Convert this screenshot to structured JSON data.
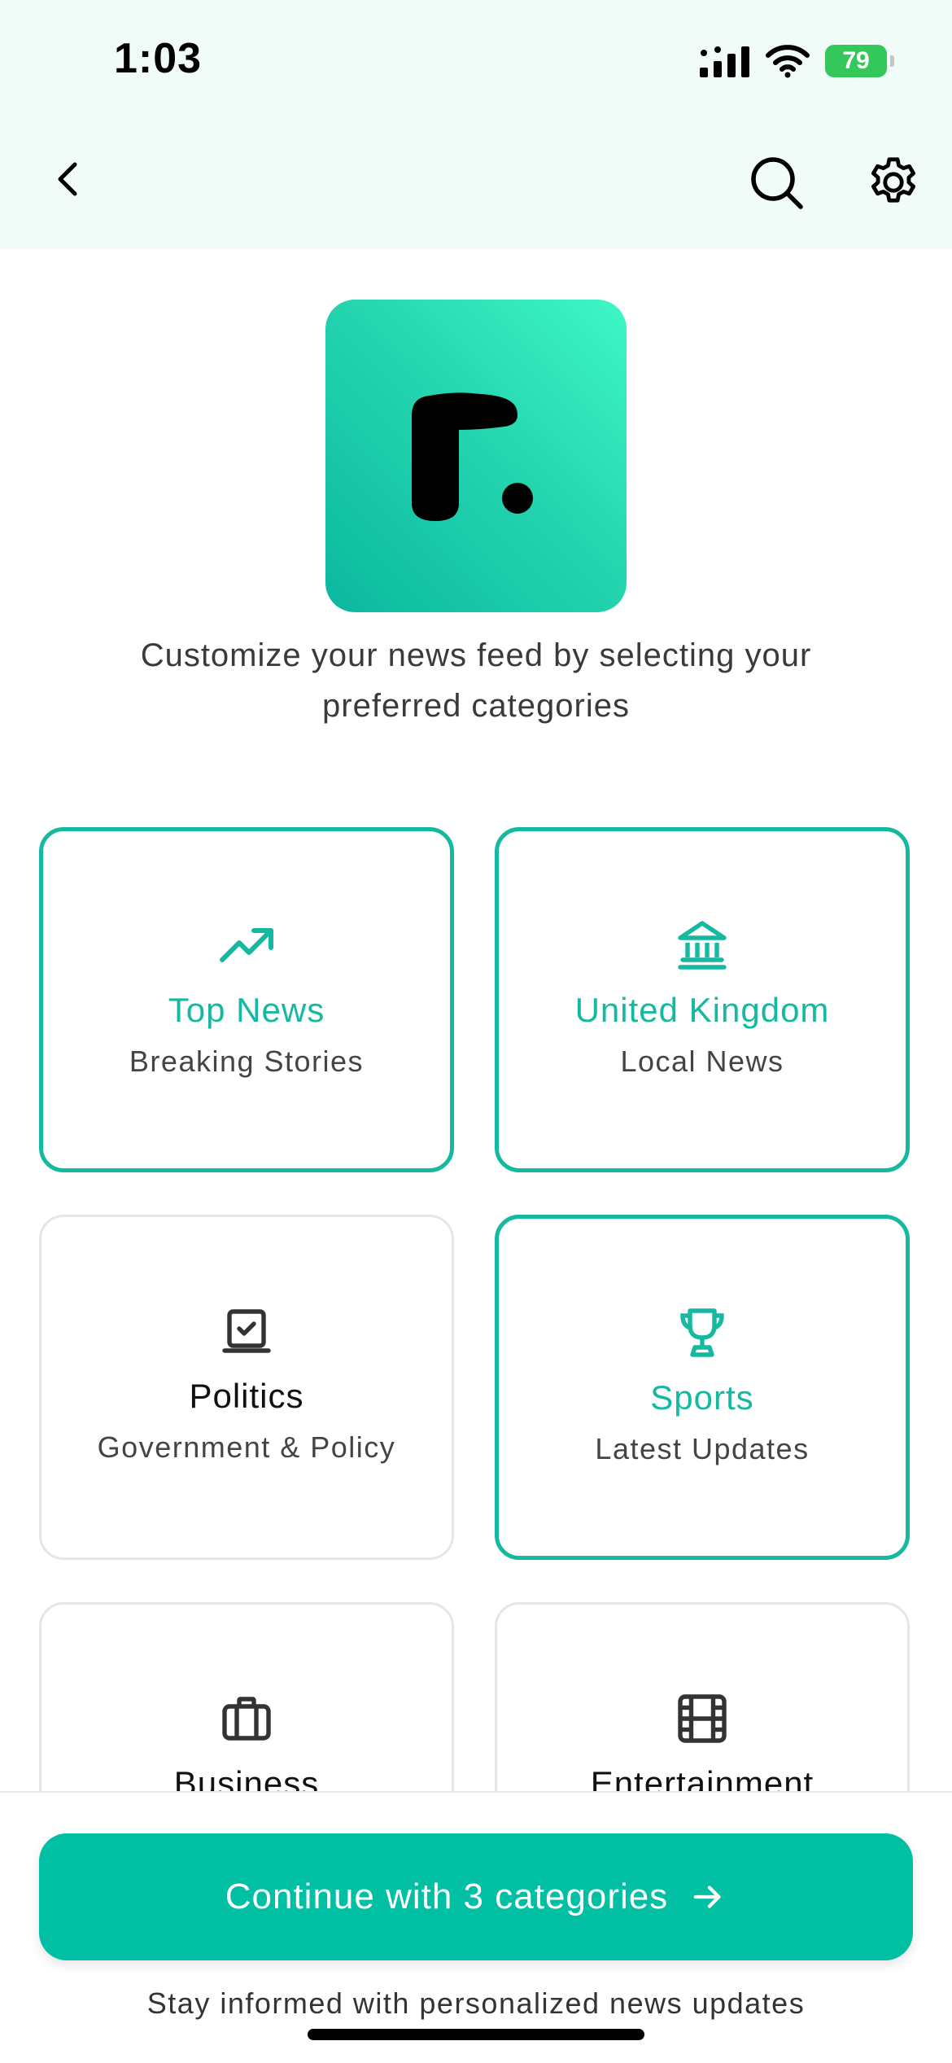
{
  "status_bar": {
    "time": "1:03",
    "battery": "79"
  },
  "intro_text": "Customize your news feed by selecting your preferred categories",
  "categories": [
    {
      "title": "Top News",
      "subtitle": "Breaking Stories",
      "icon": "trending-up-icon",
      "selected": true
    },
    {
      "title": "United Kingdom",
      "subtitle": "Local News",
      "icon": "bank-building-icon",
      "selected": true
    },
    {
      "title": "Politics",
      "subtitle": "Government & Policy",
      "icon": "ballot-box-icon",
      "selected": false
    },
    {
      "title": "Sports",
      "subtitle": "Latest Updates",
      "icon": "trophy-icon",
      "selected": true
    },
    {
      "title": "Business",
      "subtitle": "",
      "icon": "briefcase-icon",
      "selected": false
    },
    {
      "title": "Entertainment",
      "subtitle": "",
      "icon": "film-icon",
      "selected": false
    }
  ],
  "cta": {
    "label": "Continue with 3 categories"
  },
  "footer_note": "Stay informed with personalized news updates",
  "colors": {
    "accent": "#00bfa2",
    "header_bg": "#f1fbf8"
  }
}
